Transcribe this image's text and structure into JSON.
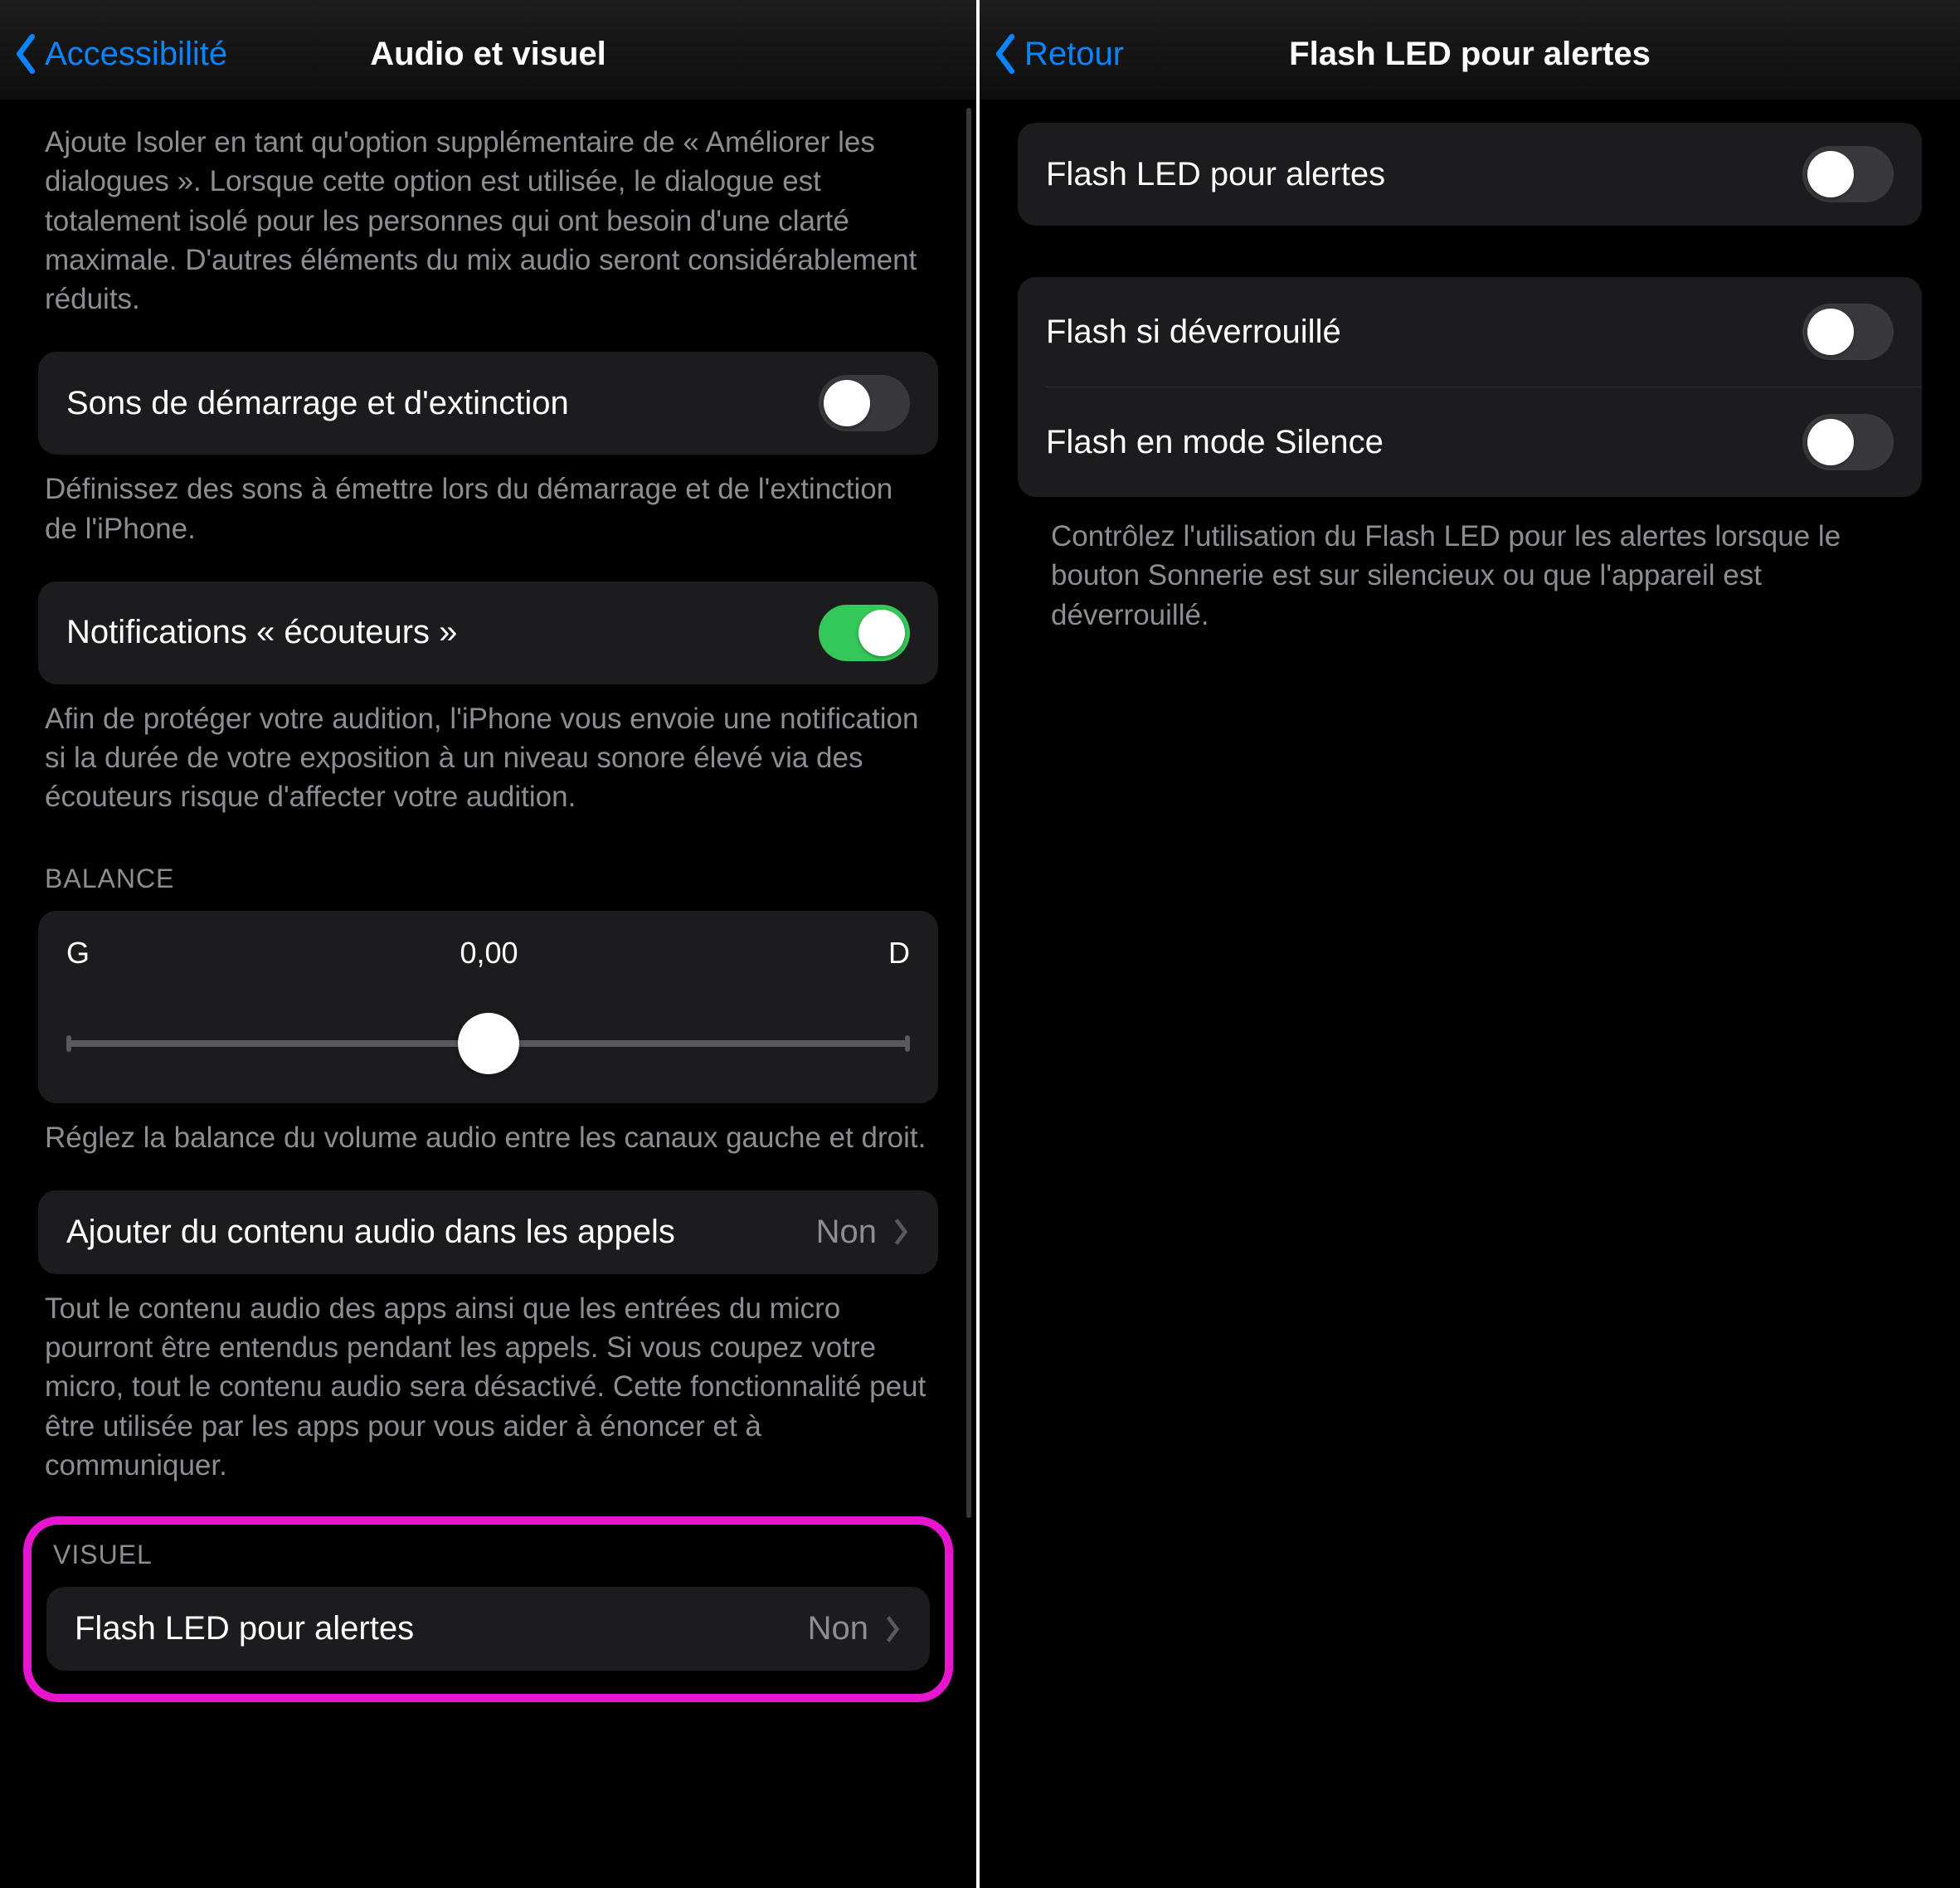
{
  "left": {
    "back": "Accessibilité",
    "title": "Audio et visuel",
    "topDesc": "Ajoute Isoler en tant qu'option supplémentaire de « Améliorer les dialogues ». Lorsque cette option est utilisée, le dialogue est totalement isolé pour les personnes qui ont besoin d'une clarté maximale. D'autres éléments du mix audio seront considérablement réduits.",
    "startupSounds": {
      "label": "Sons de démarrage et d'extinction",
      "on": false
    },
    "startupDesc": "Définissez des sons à émettre lors du démarrage et de l'extinction de l'iPhone.",
    "headphoneNotif": {
      "label": "Notifications « écouteurs »",
      "on": true
    },
    "headphoneDesc": "Afin de protéger votre audition, l'iPhone vous envoie une notification si la durée de votre exposition à un niveau sonore élevé via des écouteurs risque d'affecter votre audition.",
    "balanceHeader": "BALANCE",
    "balance": {
      "left": "G",
      "right": "D",
      "value": "0,00"
    },
    "balanceDesc": "Réglez la balance du volume audio entre les canaux gauche et droit.",
    "addAudio": {
      "label": "Ajouter du contenu audio dans les appels",
      "value": "Non"
    },
    "addAudioDesc": "Tout le contenu audio des apps ainsi que les entrées du micro pourront être entendus pendant les appels. Si vous coupez votre micro, tout le contenu audio sera désactivé. Cette fonctionnalité peut être utilisée par les apps pour vous aider à énoncer et à communiquer.",
    "visualHeader": "VISUEL",
    "flashRow": {
      "label": "Flash LED pour alertes",
      "value": "Non"
    }
  },
  "right": {
    "back": "Retour",
    "title": "Flash LED pour alertes",
    "mainToggle": {
      "label": "Flash LED pour alertes",
      "on": false
    },
    "unlock": {
      "label": "Flash si déverrouillé",
      "on": false
    },
    "silent": {
      "label": "Flash en mode Silence",
      "on": false
    },
    "desc": "Contrôlez l'utilisation du Flash LED pour les alertes lorsque le bouton Sonnerie est sur silencieux ou que l'appareil est déverrouillé."
  }
}
